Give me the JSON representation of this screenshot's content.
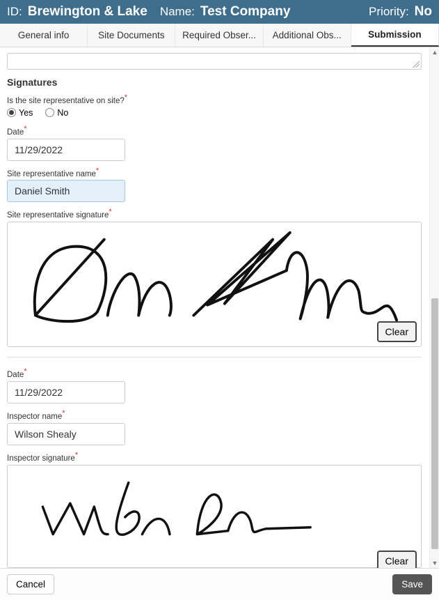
{
  "header": {
    "id_label": "ID:",
    "id_value": "Brewington & Lake",
    "name_label": "Name:",
    "name_value": "Test Company",
    "priority_label": "Priority:",
    "priority_value": "No"
  },
  "tabs": {
    "general": "General info",
    "site_docs": "Site Documents",
    "required_obs": "Required Obser...",
    "additional_obs": "Additional Obs...",
    "submission": "Submission"
  },
  "signatures": {
    "title": "Signatures",
    "rep_onsite_label": "Is the site representative on site?",
    "yes": "Yes",
    "no": "No",
    "date_label": "Date",
    "date1": "11/29/2022",
    "rep_name_label": "Site representative name",
    "rep_name": "Daniel Smith",
    "rep_sig_label": "Site representative signature",
    "clear1": "Clear",
    "date2": "11/29/2022",
    "insp_name_label": "Inspector name",
    "insp_name": "Wilson Shealy",
    "insp_sig_label": "Inspector signature",
    "clear2": "Clear"
  },
  "footer": {
    "cancel": "Cancel",
    "save": "Save"
  }
}
